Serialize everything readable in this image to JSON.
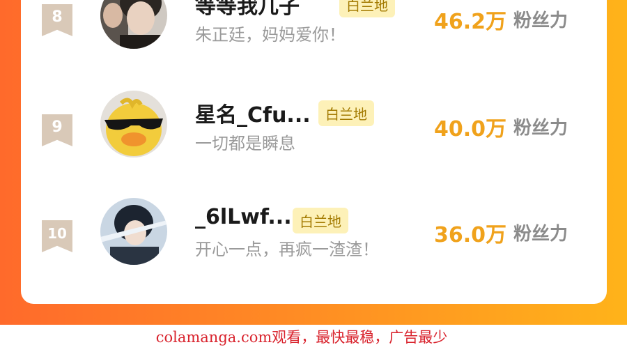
{
  "rows": [
    {
      "rank": "8",
      "name": "等等我几子",
      "tag": "白兰地",
      "motto": "朱正廷，妈妈爱你！",
      "fans": "46.2万",
      "fans_label": "粉丝力"
    },
    {
      "rank": "9",
      "name": "星名_Cfu...",
      "tag": "白兰地",
      "motto": "一切都是瞬息",
      "fans": "40.0万",
      "fans_label": "粉丝力"
    },
    {
      "rank": "10",
      "name": "_6lLwf...",
      "tag": "白兰地",
      "motto": "开心一点，再疯一渣渣！",
      "fans": "36.0万",
      "fans_label": "粉丝力"
    }
  ],
  "colors": {
    "rank_badge": "#d9c9b8",
    "fans_value": "#f0a21c",
    "tag_bg": "#fdf1b8",
    "tag_text": "#a37a00",
    "watermark": "#d9232d"
  },
  "watermark": "colamanga.com观看，最快最稳，广告最少"
}
